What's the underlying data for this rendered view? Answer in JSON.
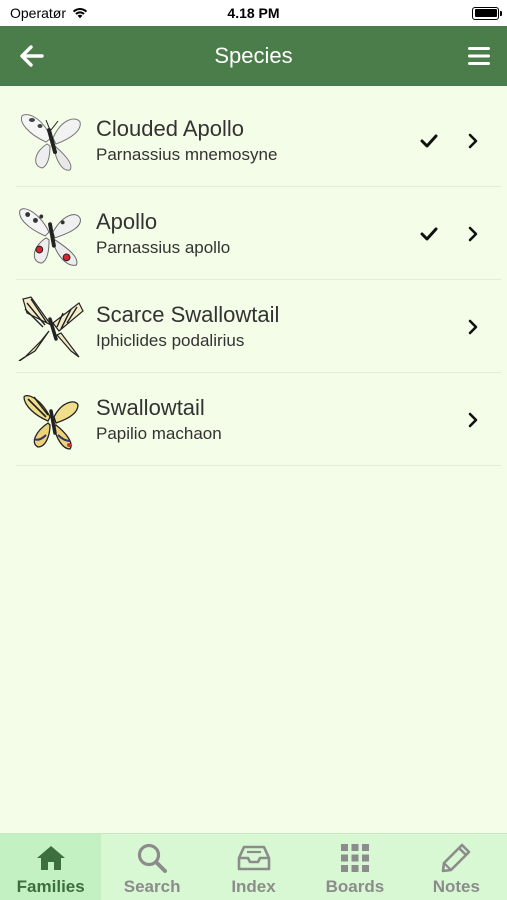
{
  "status": {
    "carrier": "Operatør",
    "time": "4.18 PM"
  },
  "nav": {
    "title": "Species",
    "back_icon": "arrow-left-icon",
    "menu_icon": "hamburger-menu-icon"
  },
  "species": [
    {
      "common": "Clouded Apollo",
      "latin": "Parnassius mnemosyne",
      "checked": true
    },
    {
      "common": "Apollo",
      "latin": "Parnassius apollo",
      "checked": true
    },
    {
      "common": "Scarce Swallowtail",
      "latin": "Iphiclides podalirius",
      "checked": false
    },
    {
      "common": "Swallowtail",
      "latin": "Papilio machaon",
      "checked": false
    }
  ],
  "tabs": [
    {
      "label": "Families",
      "icon": "home-icon",
      "active": true
    },
    {
      "label": "Search",
      "icon": "search-icon",
      "active": false
    },
    {
      "label": "Index",
      "icon": "inbox-icon",
      "active": false
    },
    {
      "label": "Boards",
      "icon": "grid-icon",
      "active": false
    },
    {
      "label": "Notes",
      "icon": "pencil-icon",
      "active": false
    }
  ],
  "colors": {
    "nav_bg": "#4a7d4a",
    "page_bg": "#f4fde8",
    "tab_bar_bg": "#d8f8d3",
    "tab_active": "#3c6f3c"
  }
}
